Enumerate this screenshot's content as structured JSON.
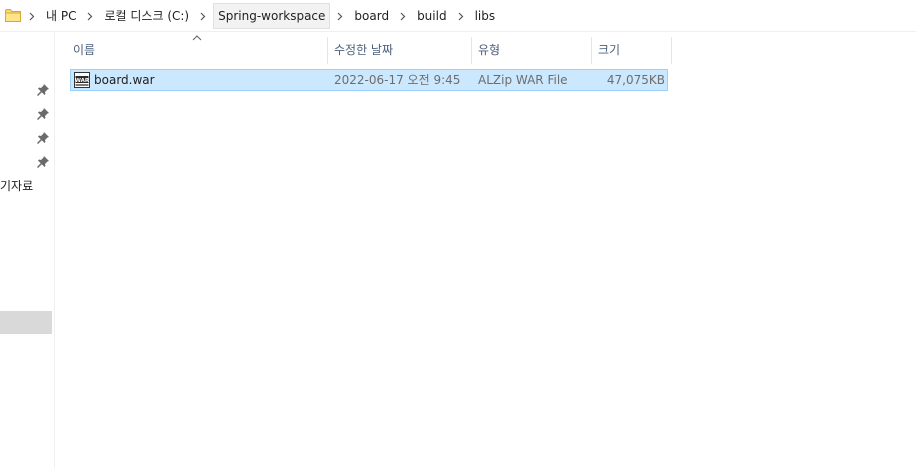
{
  "address_bar": {
    "breadcrumbs": [
      {
        "label": "내 PC"
      },
      {
        "label": "로컬 디스크 (C:)"
      },
      {
        "label": "Spring-workspace"
      },
      {
        "label": "board"
      },
      {
        "label": "build"
      },
      {
        "label": "libs"
      }
    ]
  },
  "nav_pane": {
    "partial_label": "기자료"
  },
  "columns": {
    "name": "이름",
    "date": "수정한 날짜",
    "type": "유형",
    "size": "크기"
  },
  "files": [
    {
      "name": "board.war",
      "date": "2022-06-17 오전 9:45",
      "type": "ALZip WAR File",
      "size": "47,075KB",
      "icon": "war-file-icon"
    }
  ],
  "colors": {
    "selection": "#cce8ff",
    "selection_border": "#99d1ff",
    "folder": "#f8d775"
  }
}
